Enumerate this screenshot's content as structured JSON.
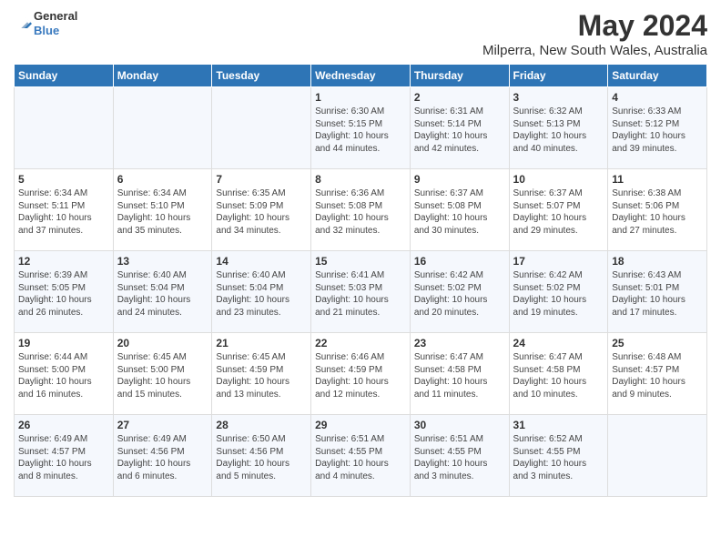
{
  "header": {
    "logo_line1": "General",
    "logo_line2": "Blue",
    "title": "May 2024",
    "subtitle": "Milperra, New South Wales, Australia"
  },
  "days_of_week": [
    "Sunday",
    "Monday",
    "Tuesday",
    "Wednesday",
    "Thursday",
    "Friday",
    "Saturday"
  ],
  "weeks": [
    [
      {
        "day": "",
        "content": ""
      },
      {
        "day": "",
        "content": ""
      },
      {
        "day": "",
        "content": ""
      },
      {
        "day": "1",
        "content": "Sunrise: 6:30 AM\nSunset: 5:15 PM\nDaylight: 10 hours\nand 44 minutes."
      },
      {
        "day": "2",
        "content": "Sunrise: 6:31 AM\nSunset: 5:14 PM\nDaylight: 10 hours\nand 42 minutes."
      },
      {
        "day": "3",
        "content": "Sunrise: 6:32 AM\nSunset: 5:13 PM\nDaylight: 10 hours\nand 40 minutes."
      },
      {
        "day": "4",
        "content": "Sunrise: 6:33 AM\nSunset: 5:12 PM\nDaylight: 10 hours\nand 39 minutes."
      }
    ],
    [
      {
        "day": "5",
        "content": "Sunrise: 6:34 AM\nSunset: 5:11 PM\nDaylight: 10 hours\nand 37 minutes."
      },
      {
        "day": "6",
        "content": "Sunrise: 6:34 AM\nSunset: 5:10 PM\nDaylight: 10 hours\nand 35 minutes."
      },
      {
        "day": "7",
        "content": "Sunrise: 6:35 AM\nSunset: 5:09 PM\nDaylight: 10 hours\nand 34 minutes."
      },
      {
        "day": "8",
        "content": "Sunrise: 6:36 AM\nSunset: 5:08 PM\nDaylight: 10 hours\nand 32 minutes."
      },
      {
        "day": "9",
        "content": "Sunrise: 6:37 AM\nSunset: 5:08 PM\nDaylight: 10 hours\nand 30 minutes."
      },
      {
        "day": "10",
        "content": "Sunrise: 6:37 AM\nSunset: 5:07 PM\nDaylight: 10 hours\nand 29 minutes."
      },
      {
        "day": "11",
        "content": "Sunrise: 6:38 AM\nSunset: 5:06 PM\nDaylight: 10 hours\nand 27 minutes."
      }
    ],
    [
      {
        "day": "12",
        "content": "Sunrise: 6:39 AM\nSunset: 5:05 PM\nDaylight: 10 hours\nand 26 minutes."
      },
      {
        "day": "13",
        "content": "Sunrise: 6:40 AM\nSunset: 5:04 PM\nDaylight: 10 hours\nand 24 minutes."
      },
      {
        "day": "14",
        "content": "Sunrise: 6:40 AM\nSunset: 5:04 PM\nDaylight: 10 hours\nand 23 minutes."
      },
      {
        "day": "15",
        "content": "Sunrise: 6:41 AM\nSunset: 5:03 PM\nDaylight: 10 hours\nand 21 minutes."
      },
      {
        "day": "16",
        "content": "Sunrise: 6:42 AM\nSunset: 5:02 PM\nDaylight: 10 hours\nand 20 minutes."
      },
      {
        "day": "17",
        "content": "Sunrise: 6:42 AM\nSunset: 5:02 PM\nDaylight: 10 hours\nand 19 minutes."
      },
      {
        "day": "18",
        "content": "Sunrise: 6:43 AM\nSunset: 5:01 PM\nDaylight: 10 hours\nand 17 minutes."
      }
    ],
    [
      {
        "day": "19",
        "content": "Sunrise: 6:44 AM\nSunset: 5:00 PM\nDaylight: 10 hours\nand 16 minutes."
      },
      {
        "day": "20",
        "content": "Sunrise: 6:45 AM\nSunset: 5:00 PM\nDaylight: 10 hours\nand 15 minutes."
      },
      {
        "day": "21",
        "content": "Sunrise: 6:45 AM\nSunset: 4:59 PM\nDaylight: 10 hours\nand 13 minutes."
      },
      {
        "day": "22",
        "content": "Sunrise: 6:46 AM\nSunset: 4:59 PM\nDaylight: 10 hours\nand 12 minutes."
      },
      {
        "day": "23",
        "content": "Sunrise: 6:47 AM\nSunset: 4:58 PM\nDaylight: 10 hours\nand 11 minutes."
      },
      {
        "day": "24",
        "content": "Sunrise: 6:47 AM\nSunset: 4:58 PM\nDaylight: 10 hours\nand 10 minutes."
      },
      {
        "day": "25",
        "content": "Sunrise: 6:48 AM\nSunset: 4:57 PM\nDaylight: 10 hours\nand 9 minutes."
      }
    ],
    [
      {
        "day": "26",
        "content": "Sunrise: 6:49 AM\nSunset: 4:57 PM\nDaylight: 10 hours\nand 8 minutes."
      },
      {
        "day": "27",
        "content": "Sunrise: 6:49 AM\nSunset: 4:56 PM\nDaylight: 10 hours\nand 6 minutes."
      },
      {
        "day": "28",
        "content": "Sunrise: 6:50 AM\nSunset: 4:56 PM\nDaylight: 10 hours\nand 5 minutes."
      },
      {
        "day": "29",
        "content": "Sunrise: 6:51 AM\nSunset: 4:55 PM\nDaylight: 10 hours\nand 4 minutes."
      },
      {
        "day": "30",
        "content": "Sunrise: 6:51 AM\nSunset: 4:55 PM\nDaylight: 10 hours\nand 3 minutes."
      },
      {
        "day": "31",
        "content": "Sunrise: 6:52 AM\nSunset: 4:55 PM\nDaylight: 10 hours\nand 3 minutes."
      },
      {
        "day": "",
        "content": ""
      }
    ]
  ]
}
